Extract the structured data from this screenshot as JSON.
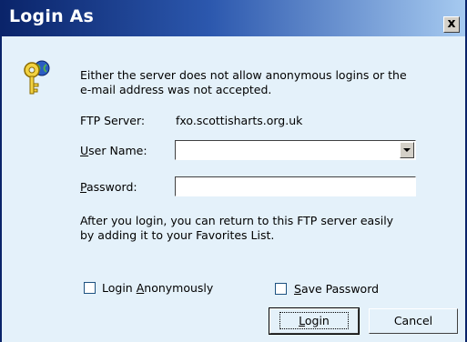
{
  "window": {
    "title": "Login As",
    "close_label": "x"
  },
  "message": {
    "line1": "Either the server does not allow anonymous logins or the",
    "line2": "e-mail address was not accepted."
  },
  "ftp_server": {
    "label": "FTP Server:",
    "value": "fxo.scottisharts.org.uk"
  },
  "username": {
    "label_key": "U",
    "label_rest": "ser Name:",
    "value": ""
  },
  "password": {
    "label_key": "P",
    "label_rest": "assword:",
    "value": ""
  },
  "info": {
    "line1": "After you login, you can return to this FTP server easily",
    "line2": "by adding it to your Favorites List."
  },
  "options": {
    "anonymous": {
      "label_pre": "Login ",
      "label_key": "A",
      "label_rest": "nonymously",
      "checked": false
    },
    "save_password": {
      "label_key": "S",
      "label_rest": "ave Password",
      "checked": false
    }
  },
  "buttons": {
    "login": {
      "key": "L",
      "rest": "ogin"
    },
    "cancel": "Cancel"
  },
  "colors": {
    "dialog_bg": "#E4F1FA",
    "title_start": "#0A246A",
    "title_end": "#A6CAF0"
  },
  "icons": {
    "dialog_icon": "key-globe-icon"
  }
}
